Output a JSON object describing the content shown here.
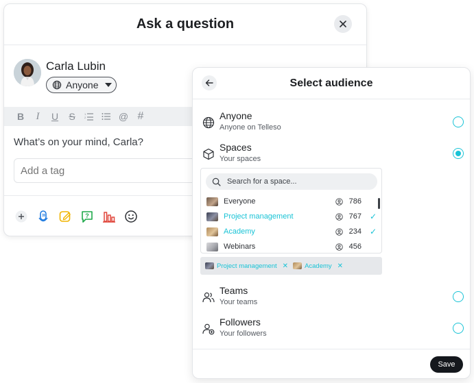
{
  "ask": {
    "title": "Ask a question",
    "user_name": "Carla Lubin",
    "audience_value": "Anyone",
    "prompt": "What’s on your mind, Carla?",
    "tag_placeholder": "Add a tag",
    "toolbar": [
      "B",
      "I",
      "U",
      "S",
      "ordered-list",
      "bullet-list",
      "@",
      "#"
    ],
    "actions": [
      "plus-icon",
      "microphone-icon",
      "edit-icon",
      "question-bubble-icon",
      "chart-icon",
      "emoji-icon"
    ]
  },
  "audience": {
    "title": "Select audience",
    "selected": "Spaces",
    "options": [
      {
        "title": "Anyone",
        "subtitle": "Anyone on Telleso",
        "icon": "globe-icon",
        "selected": false
      },
      {
        "title": "Spaces",
        "subtitle": "Your spaces",
        "icon": "cube-icon",
        "selected": true
      },
      {
        "title": "Teams",
        "subtitle": "Your teams",
        "icon": "team-icon",
        "selected": false
      },
      {
        "title": "Followers",
        "subtitle": "Your followers",
        "icon": "followers-icon",
        "selected": false
      }
    ],
    "search_placeholder": "Search for a space...",
    "spaces": [
      {
        "name": "Everyone",
        "count": "786",
        "selected": false
      },
      {
        "name": "Project management",
        "count": "767",
        "selected": true
      },
      {
        "name": "Academy",
        "count": "234",
        "selected": true
      },
      {
        "name": "Webinars",
        "count": "456",
        "selected": false
      }
    ],
    "chips": [
      "Project management",
      "Academy"
    ],
    "save_label": "Save",
    "accent": "#19c3d6"
  }
}
